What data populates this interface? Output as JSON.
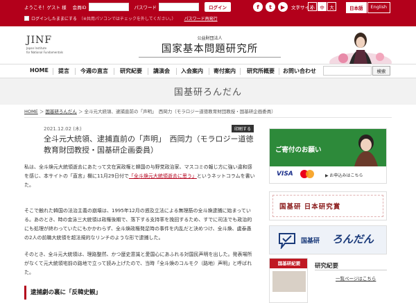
{
  "topbar": {
    "welcome": "ようこそ！ゲスト 様",
    "member_id_label": "会員ID",
    "password_label": "パスワード",
    "login_button": "ログイン",
    "keep_login": "ログインしたままにする",
    "keep_login_note": "（※共用パソコンではチェックを外してください。）",
    "password_reissue": "パスワード再発行",
    "font_size_label": "文字サイズ",
    "font_sizes": [
      "小",
      "中",
      "大"
    ],
    "languages": [
      "日本語",
      "English"
    ]
  },
  "social_icons": [
    {
      "name": "facebook-icon",
      "glyph": "f"
    },
    {
      "name": "twitter-icon",
      "glyph": "t"
    },
    {
      "name": "youtube-icon",
      "glyph": "▶"
    }
  ],
  "header": {
    "logo_text": "JINF",
    "logo_sub1": "Japan Institute",
    "logo_sub2": "for National Fundamentals",
    "org_sub": "公益財団法人",
    "org_name": "国家基本問題研究所"
  },
  "nav": {
    "items": [
      "HOME",
      "提言",
      "今週の直言",
      "研究紀要",
      "講演会",
      "入会案内",
      "寄付案内",
      "研究所概要",
      "お問い合わせ"
    ],
    "search_button": "検索"
  },
  "section_title": "国基研ろんだん",
  "breadcrumb": {
    "home": "HOME",
    "parent": "国基研ろんだん",
    "current": "全斗元大統領、逮捕直前の「声明」　西岡力（モラロジー道徳教育財団教授・国基研企画委員）"
  },
  "article": {
    "date": "2021.12.02 (木)",
    "print_button": "印刷する",
    "title": "全斗元大統領、逮捕直前の「声明」　西岡力（モラロジー道徳教育財団教授・国基研企画委員）",
    "p1_before": "私は、全斗煥元大統領逝去にあたって文在寅政権と韓国の与野党政治家、マスコミの報じ方に強い違和感を感じ、本サイトの「直言」欄に11月29日付で",
    "p1_link": "「全斗煥元大統領逝去に思う」",
    "p1_after": "というネットコラムを書いた。",
    "p2": "そこで触れた韓国の法治主義の崩壊は、1995年12月の遡及立法による無理筋の全斗煥逮捕に始まっている。あのとき、時の金泳三大統領は政権後期で、落下する支持率を挽回するため、すでに司法でも政治的にも処理が終わっていたにもかかわらず、全斗煥政権発足時の事件を内乱だと決めつけ、全斗煥、盧泰愚の2人の前職大統領を超法規的なリンチのような形で逮捕した。",
    "p3": "そのとき、全斗元大統領は、理路整然、かつ歴史意識と愛国心にあふれる対国民声明を出した。発表場所がなくて元大統領宅前の路地で立って読み上げたので、当時「全斗煥のコルモク（路地）声明」と呼ばれた。",
    "subheading": "逮捕劇の裏に「反韓史観」"
  },
  "sidebar": {
    "donate_text": "ご寄付のお願い",
    "donate_visa": "VISA",
    "donate_hint": "▶ お申込みはこちら",
    "award_text": "国基研 日本研究賞",
    "rondan_text1": "国基研",
    "rondan_text2": "ろんだん",
    "book_header": "国基研紀要",
    "kenkyu_title": "研究紀要",
    "kenkyu_more": "一覧ページはこちら"
  },
  "colors": {
    "brand_red": "#b3001b",
    "accent_green": "#2d8a3a",
    "rondan_blue": "#1a3a7a"
  }
}
